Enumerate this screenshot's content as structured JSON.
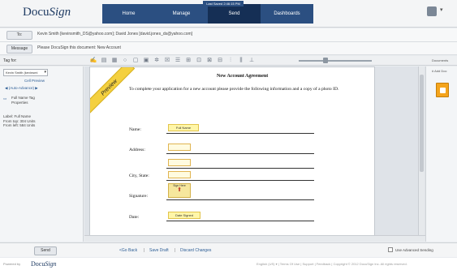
{
  "header": {
    "logo_part1": "Docu",
    "logo_part2": "Sign",
    "last_saved": "Last Saved 2:46:15 PM",
    "nav": [
      {
        "label": "Home"
      },
      {
        "label": "Manage"
      },
      {
        "label": "Send",
        "active": true
      },
      {
        "label": "Dashboards"
      }
    ],
    "accent_color": "#2b4f81"
  },
  "recipients": {
    "to_button": "To:",
    "to_value": "Kevin Smith [kevinsmith_DS@yahoo.com]; David Jones [david.jones_ds@yahoo.com]",
    "message_button": "Message",
    "message_value": "Please DocuSign this document: New Account"
  },
  "toolbar": {
    "tag_for_label": "Tag for:",
    "icons": [
      "signature-icon",
      "initials-icon",
      "date-icon",
      "circle-icon",
      "box-icon",
      "stamp-icon",
      "gear-icon",
      "checkbox-icon",
      "list-icon",
      "text-icon",
      "note-icon",
      "approve-icon",
      "formula-icon",
      "attachment-icon",
      "company-icon",
      "title-icon"
    ],
    "documents_label": "Documents"
  },
  "left_panel": {
    "recipient_select": "Kevin Smith (kevinsmi",
    "cell_preview": "Cell Preview",
    "auto_advance": "(Auto-Advance)",
    "tag_properties_line1": "Full Name Tag",
    "tag_properties_line2": "Properties",
    "label_info": "Label: Full Name\nFrom top: 304 Units\nFrom left: 584 Units"
  },
  "document": {
    "preview_ribbon": "Preview",
    "title": "New Account Agreement",
    "body": "To complete your application for a new account please provide the following information and a copy of a photo ID.",
    "fields": [
      {
        "label": "Name:",
        "tag": "Full Name"
      },
      {
        "label": "Address:",
        "tag": ""
      },
      {
        "label": "City, State:",
        "tag": ""
      },
      {
        "label": "Signature:",
        "tag": "Sign Here"
      },
      {
        "label": "Date:",
        "tag": "Date Signed"
      }
    ]
  },
  "right_panel": {
    "label": "# Add Doc"
  },
  "footer": {
    "send_button": "Send",
    "go_back": "<Go Back",
    "save_draft": "Save Draft",
    "discard_changes": "Discard Changes",
    "advanced_label": "Use Advanced Sending"
  },
  "bottombar": {
    "powered_by": "Powered by",
    "logo_part1": "Docu",
    "logo_part2": "Sign",
    "links": "English (US) ▾  |  Terms Of Use  |  Support  |  Feedback  |  Copyright © 2012 DocuSign Inc. All rights reserved."
  }
}
